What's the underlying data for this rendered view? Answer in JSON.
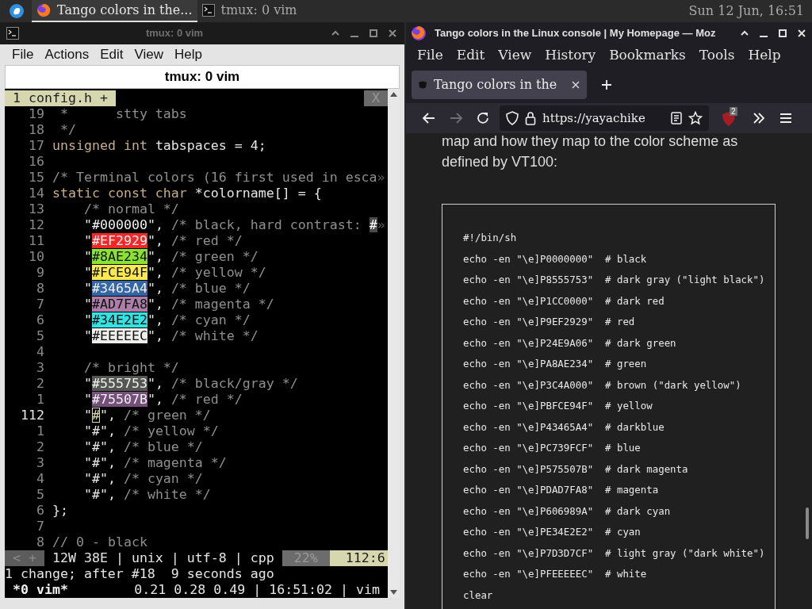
{
  "panel": {
    "taskbar": [
      {
        "label": "Tango colors in the...",
        "kind": "browser",
        "selected": true
      },
      {
        "label": "tmux: 0 vim",
        "kind": "terminal",
        "selected": false
      }
    ],
    "clock": "Sun 12 Jun, 16:51"
  },
  "terminal_window": {
    "title": "tmux: 0 vim",
    "menu": [
      "File",
      "Actions",
      "Edit",
      "View",
      "Help"
    ],
    "tab_title": "tmux: 0 vim",
    "vim": {
      "tabline": {
        "tab": "1 config.h +",
        "close": "X"
      },
      "lines": [
        {
          "number": "19",
          "current": false,
          "segments": [
            {
              "text": " *      stty tabs",
              "kind": "comment"
            }
          ]
        },
        {
          "number": "18",
          "current": false,
          "segments": [
            {
              "text": " */",
              "kind": "comment"
            }
          ]
        },
        {
          "number": "17",
          "current": false,
          "segments": [
            {
              "text": "unsigned int",
              "kind": "keyword"
            },
            {
              "text": " tabspaces = 4;",
              "kind": "plain"
            }
          ]
        },
        {
          "number": "16",
          "current": false
        },
        {
          "number": "15",
          "current": false,
          "segments": [
            {
              "text": "/* Terminal colors (16 first used in esca",
              "kind": "comment"
            },
            {
              "text": "»",
              "kind": "overflow"
            }
          ]
        },
        {
          "number": "14",
          "current": false,
          "segments": [
            {
              "text": "static const char",
              "kind": "keyword"
            },
            {
              "text": " *colorname[] = {",
              "kind": "plain"
            }
          ]
        },
        {
          "number": "13",
          "current": false,
          "segments": [
            {
              "text": "    /* normal */",
              "kind": "comment"
            }
          ]
        },
        {
          "number": "12",
          "current": false,
          "segments": [
            {
              "text": "    \"",
              "kind": "plain"
            },
            {
              "text": "#000000",
              "kind": "swatch",
              "color": "#000000"
            },
            {
              "text": "\", ",
              "kind": "plain"
            },
            {
              "text": "/* black, hard contrast: ",
              "kind": "comment"
            },
            {
              "text": "#",
              "kind": "match"
            },
            {
              "text": "»",
              "kind": "overflow"
            }
          ]
        },
        {
          "number": "11",
          "current": false,
          "segments": [
            {
              "text": "    \"",
              "kind": "plain"
            },
            {
              "text": "#EF2929",
              "kind": "swatch",
              "color": "#ef2929"
            },
            {
              "text": "\", ",
              "kind": "plain"
            },
            {
              "text": "/* red */",
              "kind": "comment"
            }
          ]
        },
        {
          "number": "10",
          "current": false,
          "segments": [
            {
              "text": "    \"",
              "kind": "plain"
            },
            {
              "text": "#8AE234",
              "kind": "swatch",
              "color": "#8ae234"
            },
            {
              "text": "\", ",
              "kind": "plain"
            },
            {
              "text": "/* green */",
              "kind": "comment"
            }
          ]
        },
        {
          "number": "9",
          "current": false,
          "segments": [
            {
              "text": "    \"",
              "kind": "plain"
            },
            {
              "text": "#FCE94F",
              "kind": "swatch",
              "color": "#fce94f"
            },
            {
              "text": "\", ",
              "kind": "plain"
            },
            {
              "text": "/* yellow */",
              "kind": "comment"
            }
          ]
        },
        {
          "number": "8",
          "current": false,
          "segments": [
            {
              "text": "    \"",
              "kind": "plain"
            },
            {
              "text": "#3465A4",
              "kind": "swatch",
              "color": "#3465a4"
            },
            {
              "text": "\", ",
              "kind": "plain"
            },
            {
              "text": "/* blue */",
              "kind": "comment"
            }
          ]
        },
        {
          "number": "7",
          "current": false,
          "segments": [
            {
              "text": "    \"",
              "kind": "plain"
            },
            {
              "text": "#AD7FA8",
              "kind": "swatch",
              "color": "#ad7fa8"
            },
            {
              "text": "\", ",
              "kind": "plain"
            },
            {
              "text": "/* magenta */",
              "kind": "comment"
            }
          ]
        },
        {
          "number": "6",
          "current": false,
          "segments": [
            {
              "text": "    \"",
              "kind": "plain"
            },
            {
              "text": "#34E2E2",
              "kind": "swatch",
              "color": "#34e2e2"
            },
            {
              "text": "\", ",
              "kind": "plain"
            },
            {
              "text": "/* cyan */",
              "kind": "comment"
            }
          ]
        },
        {
          "number": "5",
          "current": false,
          "segments": [
            {
              "text": "    \"",
              "kind": "plain"
            },
            {
              "text": "#EEEEEC",
              "kind": "swatch",
              "color": "#eeeeec"
            },
            {
              "text": "\", ",
              "kind": "plain"
            },
            {
              "text": "/* white */",
              "kind": "comment"
            }
          ]
        },
        {
          "number": "4",
          "current": false
        },
        {
          "number": "3",
          "current": false,
          "segments": [
            {
              "text": "    /* bright */",
              "kind": "comment"
            }
          ]
        },
        {
          "number": "2",
          "current": false,
          "segments": [
            {
              "text": "    \"",
              "kind": "plain"
            },
            {
              "text": "#555753",
              "kind": "swatch",
              "color": "#555753"
            },
            {
              "text": "\", ",
              "kind": "plain"
            },
            {
              "text": "/* black/gray */",
              "kind": "comment"
            }
          ]
        },
        {
          "number": "1",
          "current": false,
          "segments": [
            {
              "text": "    \"",
              "kind": "plain"
            },
            {
              "text": "#75507B",
              "kind": "swatch",
              "color": "#75507b"
            },
            {
              "text": "\", ",
              "kind": "plain"
            },
            {
              "text": "/* red */",
              "kind": "comment"
            }
          ]
        },
        {
          "number": "112",
          "current": true,
          "segments": [
            {
              "text": "    \"",
              "kind": "plain"
            },
            {
              "text": "#",
              "kind": "cursor"
            },
            {
              "text": "\", ",
              "kind": "plain"
            },
            {
              "text": "/* green */",
              "kind": "comment"
            }
          ]
        },
        {
          "number": "1",
          "current": false,
          "segments": [
            {
              "text": "    \"#\", ",
              "kind": "plain"
            },
            {
              "text": "/* yellow */",
              "kind": "comment"
            }
          ]
        },
        {
          "number": "2",
          "current": false,
          "segments": [
            {
              "text": "    \"#\", ",
              "kind": "plain"
            },
            {
              "text": "/* blue */",
              "kind": "comment"
            }
          ]
        },
        {
          "number": "3",
          "current": false,
          "segments": [
            {
              "text": "    \"#\", ",
              "kind": "plain"
            },
            {
              "text": "/* magenta */",
              "kind": "comment"
            }
          ]
        },
        {
          "number": "4",
          "current": false,
          "segments": [
            {
              "text": "    \"#\", ",
              "kind": "plain"
            },
            {
              "text": "/* cyan */",
              "kind": "comment"
            }
          ]
        },
        {
          "number": "5",
          "current": false,
          "segments": [
            {
              "text": "    \"#\", ",
              "kind": "plain"
            },
            {
              "text": "/* white */",
              "kind": "comment"
            }
          ]
        },
        {
          "number": "6",
          "current": false,
          "segments": [
            {
              "text": "};",
              "kind": "plain"
            }
          ]
        },
        {
          "number": "7",
          "current": false
        },
        {
          "number": "8",
          "current": false,
          "segments": [
            {
              "text": "// 0 - black",
              "kind": "comment"
            }
          ]
        }
      ],
      "statusline": [
        {
          "text": "< +",
          "kind": "inactive"
        },
        {
          "text": "12W 38E | unix | utf-8 | cpp",
          "kind": "info"
        },
        {
          "text": "22%",
          "kind": "percent"
        },
        {
          "text": "112:6",
          "kind": "position"
        }
      ],
      "message": "1 change; after #18  9 seconds ago"
    },
    "tmux_status": {
      "left": "*0 vim*",
      "right": "0.21 0.28 0.49 | 16:51:02 | vim"
    }
  },
  "browser_window": {
    "title": "Tango colors in the Linux console | My Homepage — Moz",
    "menu": [
      "File",
      "Edit",
      "View",
      "History",
      "Bookmarks",
      "Tools",
      "Help"
    ],
    "tabs": [
      {
        "label": "Tango colors in the",
        "selected": true
      }
    ],
    "url": "https://yayachike",
    "extension_badge": "2",
    "content": {
      "paragraph": "map and how they map to the color scheme as defined by VT100:",
      "code_lines": [
        "#!/bin/sh",
        "echo -en \"\\e]P0000000\"  # black",
        "echo -en \"\\e]P8555753\"  # dark gray (\"light black\")",
        "echo -en \"\\e]P1CC0000\"  # dark red",
        "echo -en \"\\e]P9EF2929\"  # red",
        "echo -en \"\\e]P24E9A06\"  # dark green",
        "echo -en \"\\e]PA8AE234\"  # green",
        "echo -en \"\\e]P3C4A000\"  # brown (\"dark yellow\")",
        "echo -en \"\\e]PBFCE94F\"  # yellow",
        "echo -en \"\\e]P43465A4\"  # darkblue",
        "echo -en \"\\e]PC739FCF\"  # blue",
        "echo -en \"\\e]P575507B\"  # dark magenta",
        "echo -en \"\\e]PDAD7FA8\"  # magenta",
        "echo -en \"\\e]P606989A\"  # dark cyan",
        "echo -en \"\\e]PE34E2E2\"  # cyan",
        "echo -en \"\\e]P7D3D7CF\"  # light gray (\"dark white\")",
        "echo -en \"\\e]PFEEEEEC\"  # white",
        "clear"
      ]
    }
  }
}
